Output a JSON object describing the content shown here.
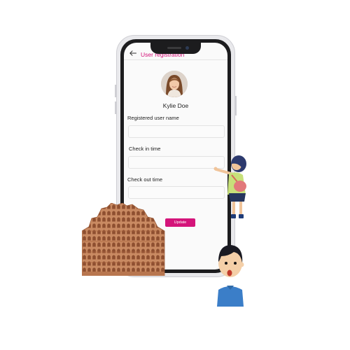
{
  "app": {
    "title": "User registration",
    "back_icon": "arrow-left-icon",
    "accent_color": "#d4147a"
  },
  "profile": {
    "name": "Kylie Doe",
    "avatar_icon": "user-avatar"
  },
  "form": {
    "fields": [
      {
        "label": "Registered user name",
        "value": "",
        "placeholder": ""
      },
      {
        "label": "Check in time",
        "value": "",
        "placeholder": ""
      },
      {
        "label": "Check out time",
        "value": "",
        "placeholder": ""
      }
    ],
    "submit_label": "Update"
  }
}
